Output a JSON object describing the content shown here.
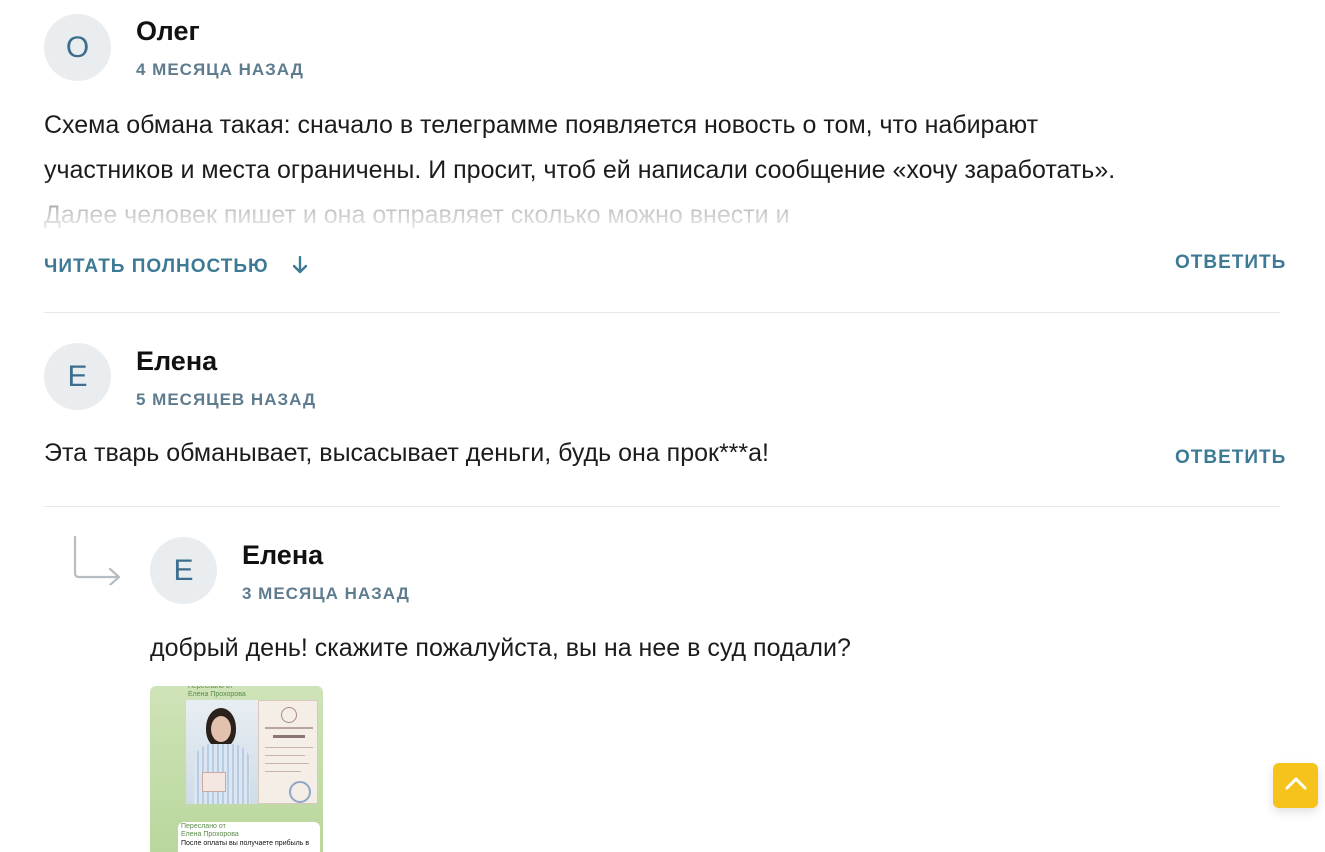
{
  "comments": [
    {
      "initial": "О",
      "author": "Олег",
      "date": "4 МЕСЯЦА НАЗАД",
      "text": "Схема обмана такая: сначало в телеграмме появляется новость о том, что набирают участников и места ограничены. И просит, чтоб ей написали сообщение «хочу заработать». Далее человек пишет и она отправляет сколько можно внести и",
      "read_more_label": "ЧИТАТЬ ПОЛНОСТЬЮ",
      "reply_label": "ОТВЕТИТЬ"
    },
    {
      "initial": "Е",
      "author": "Елена",
      "date": "5 МЕСЯЦЕВ НАЗАД",
      "text": "Эта тварь обманывает, высасывает деньги, будь она прок***а!",
      "reply_label": "ОТВЕТИТЬ"
    }
  ],
  "reply": {
    "initial": "Е",
    "author": "Елена",
    "date": "3 МЕСЯЦА НАЗАД",
    "text": "добрый день! скажите пожалуйста, вы на нее в суд подали?",
    "attachment": {
      "forwarded_label": "Переслано от",
      "forwarded_name": "Елена Прохорова",
      "caption": "После оплаты вы получаете прибыль в"
    }
  },
  "colors": {
    "accent": "#3d7a95",
    "avatar_bg": "#e9edf0",
    "scroll_button": "#f6c21c"
  },
  "icons": {
    "read_more": "arrow-down-icon",
    "reply_indicator": "reply-arrow-icon",
    "scroll_top": "chevron-up-icon"
  }
}
